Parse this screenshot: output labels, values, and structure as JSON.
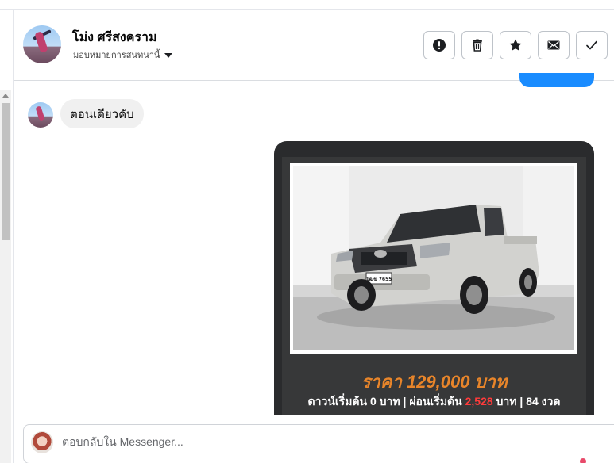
{
  "conversation": {
    "contact_name": "โม่ง ศรีสงคราม",
    "assign_label": "มอบหมายการสนทนานี้"
  },
  "header_actions": [
    {
      "name": "report-button",
      "icon": "exclamation-icon"
    },
    {
      "name": "delete-button",
      "icon": "trash-icon"
    },
    {
      "name": "star-button",
      "icon": "star-icon"
    },
    {
      "name": "mark-unread-button",
      "icon": "envelope-icon"
    },
    {
      "name": "mark-done-button",
      "icon": "check-icon"
    }
  ],
  "messages": {
    "incoming_text": "ตอนเดียวคับ"
  },
  "ad_card": {
    "price": "ราคา 129,000 บาท",
    "terms_prefix": "ดาวน์เริ่มต้น 0 บาท | ผ่อนเริ่มต้น ",
    "terms_amount": "2,528",
    "terms_suffix": " บาท | 84 งวด",
    "plate": "1ฒฆ 7655",
    "colors": {
      "card_bg": "#2a2b2d",
      "price": "#e8852a",
      "amount": "#ff3b3b"
    }
  },
  "reply": {
    "placeholder": "ตอบกลับใน Messenger..."
  },
  "accent_color": "#1a8cff"
}
